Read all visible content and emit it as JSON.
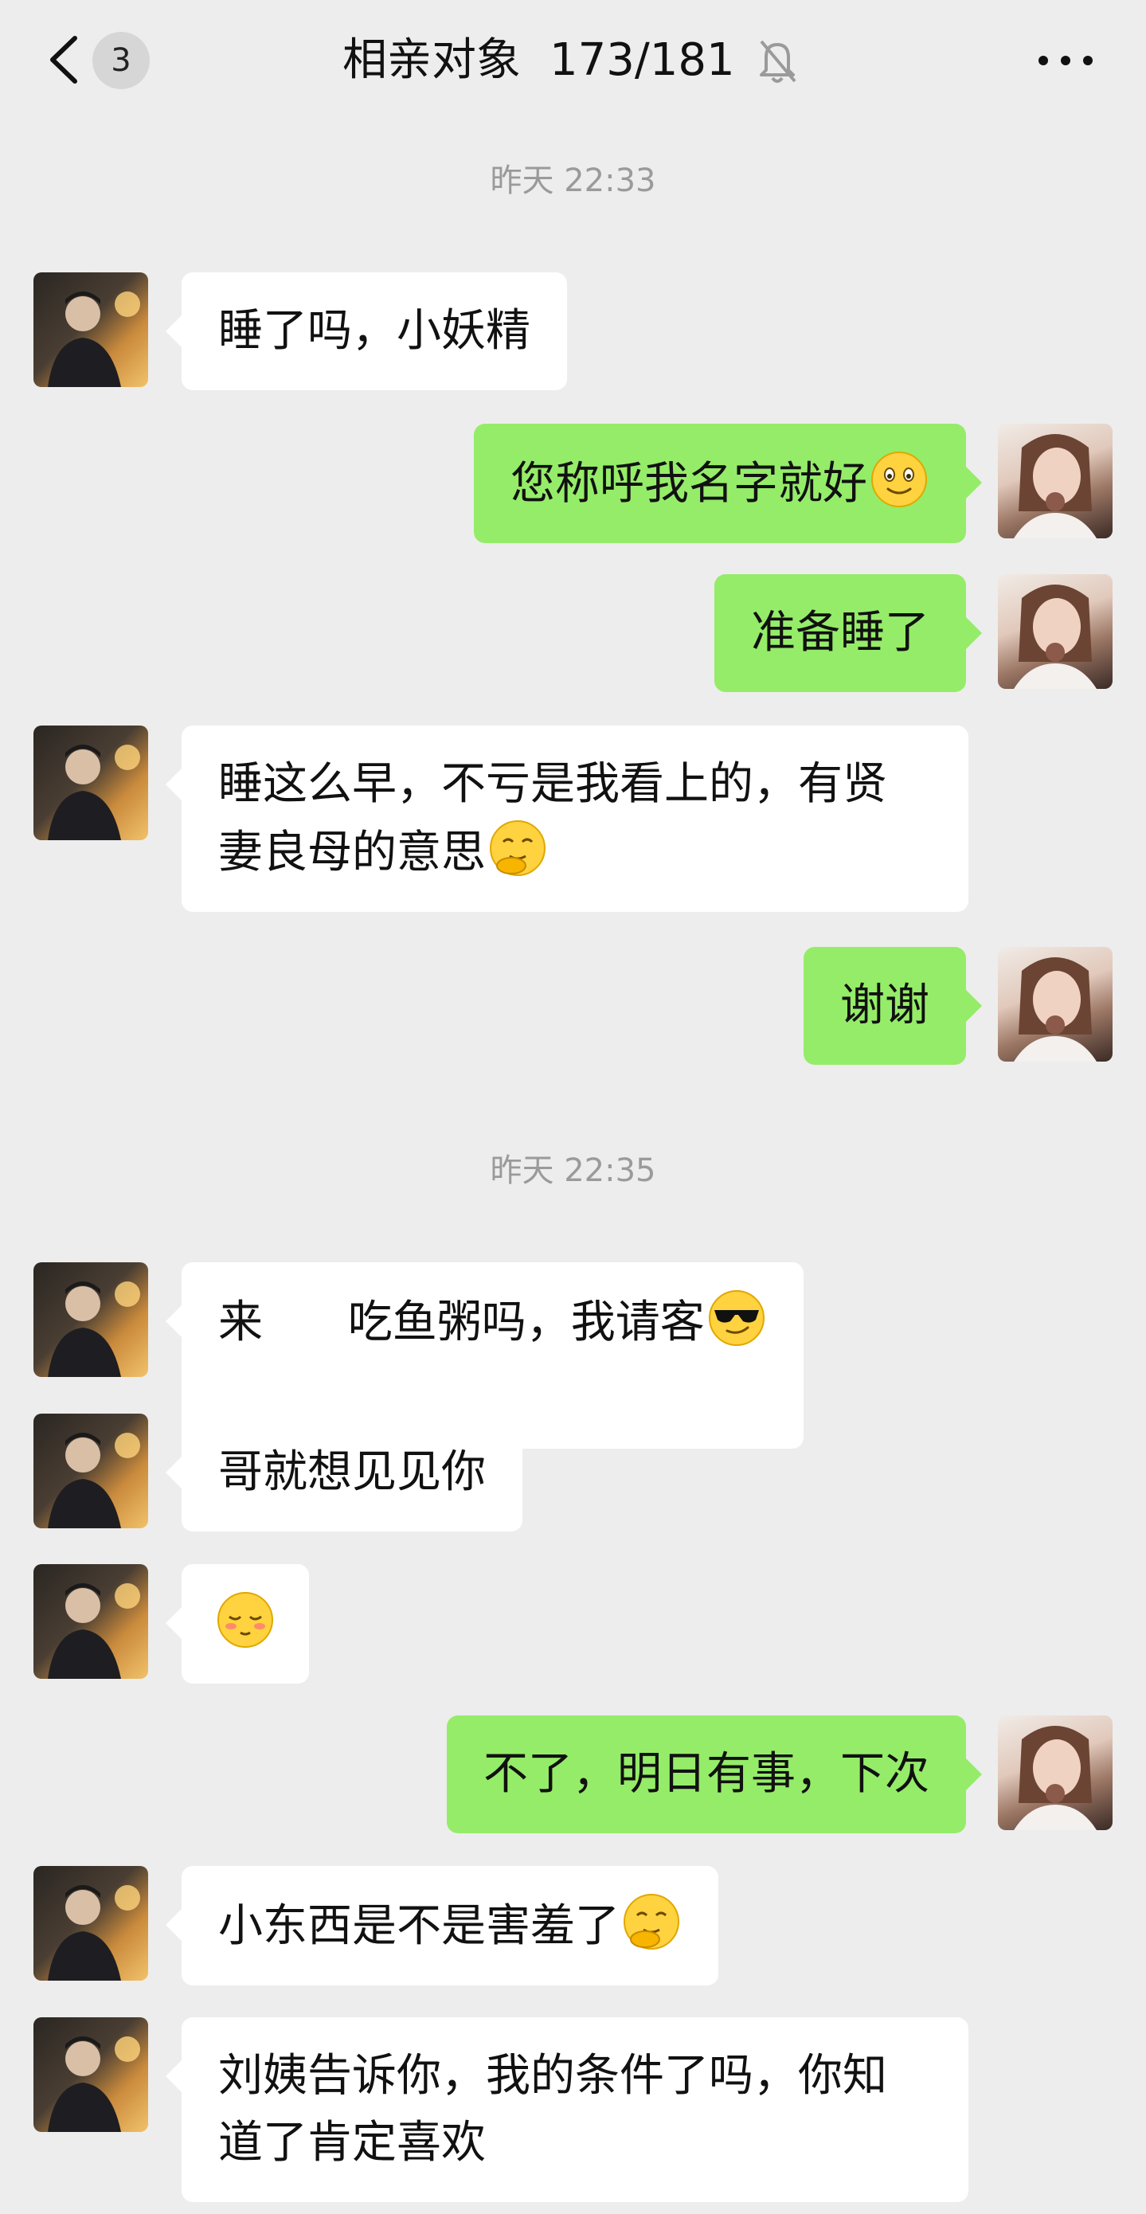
{
  "header": {
    "unread_count": "3",
    "title": "相亲对象",
    "member_count": "173/181"
  },
  "timestamps": [
    "昨天 22:33",
    "昨天 22:35"
  ],
  "messages": [
    {
      "side": "left",
      "text": "睡了吗，小妖精"
    },
    {
      "side": "right",
      "text": "您称呼我名字就好",
      "emoji": "smile-face"
    },
    {
      "side": "right",
      "text": "准备睡了"
    },
    {
      "side": "left",
      "text": "睡这么早，不亏是我看上的，有贤\n妻良母的意思",
      "emoji": "thinking-face"
    },
    {
      "side": "right",
      "text": "谢谢"
    },
    {
      "side": "left",
      "text": "来      吃鱼粥吗，我请客",
      "emoji": "sunglasses-face"
    },
    {
      "side": "left",
      "text": "哥就想见见你"
    },
    {
      "side": "left",
      "text": "",
      "emoji": "shy-face"
    },
    {
      "side": "right",
      "text": "不了，明日有事，下次"
    },
    {
      "side": "left",
      "text": "小东西是不是害羞了",
      "emoji": "thinking-face"
    },
    {
      "side": "left",
      "text": "刘姨告诉你，我的条件了吗，你知\n道了肯定喜欢"
    }
  ],
  "colors": {
    "background": "#ededed",
    "sent_bubble": "#95ec69",
    "received_bubble": "#ffffff",
    "timestamp": "#9a9a9a"
  },
  "icons": [
    "back-arrow-icon",
    "mute-bell-icon",
    "more-options-icon"
  ]
}
